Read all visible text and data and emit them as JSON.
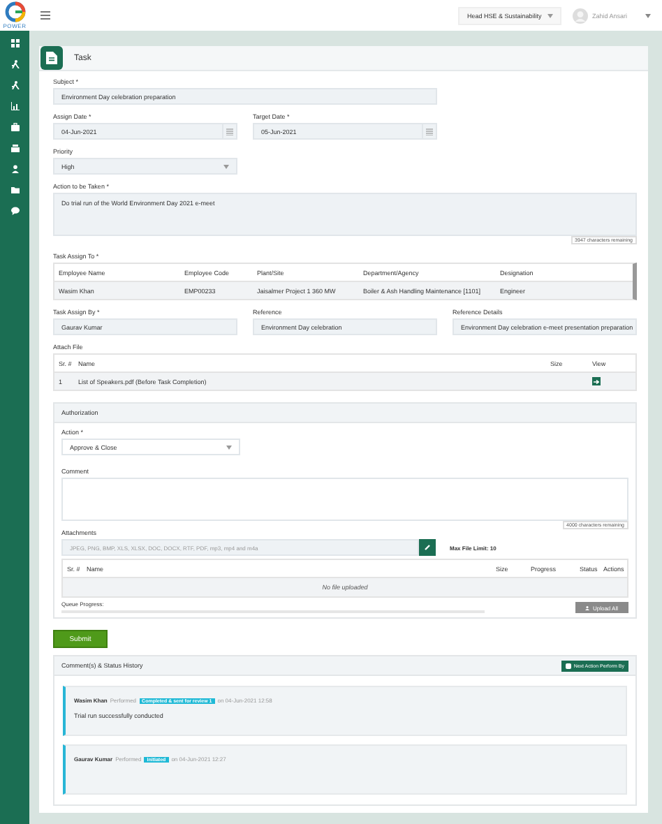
{
  "header": {
    "logo_text": "POWER",
    "role_selector": "Head HSE & Sustainability",
    "user_name": "Zahid Ansari"
  },
  "page_title": "Task",
  "subject": {
    "label": "Subject *",
    "value": "Environment Day celebration preparation"
  },
  "assign_date": {
    "label": "Assign Date *",
    "value": "04-Jun-2021"
  },
  "target_date": {
    "label": "Target Date *",
    "value": "05-Jun-2021"
  },
  "priority": {
    "label": "Priority",
    "value": "High"
  },
  "action_to_be_taken": {
    "label": "Action to be Taken *",
    "value": "Do trial run of the World Environment Day 2021 e-meet",
    "counter": "3947 characters remaining"
  },
  "task_assign_to": {
    "label": "Task Assign To *",
    "columns": [
      "Employee Name",
      "Employee Code",
      "Plant/Site",
      "Department/Agency",
      "Designation"
    ],
    "rows": [
      [
        "Wasim Khan",
        "EMP00233",
        "Jaisalmer Project 1 360 MW",
        "Boiler & Ash Handling Maintenance [1101]",
        "Engineer"
      ]
    ]
  },
  "task_assign_by": {
    "label": "Task Assign By *",
    "value": "Gaurav Kumar"
  },
  "reference": {
    "label": "Reference",
    "value": "Environment Day celebration"
  },
  "reference_details": {
    "label": "Reference Details",
    "value": "Environment Day celebration e-meet presentation preparation"
  },
  "attach_file": {
    "label": "Attach File",
    "columns": [
      "Sr. #",
      "Name",
      "Size",
      "View"
    ],
    "rows": [
      {
        "sr": "1",
        "name": "List of Speakers.pdf (Before Task Completion)",
        "size": ""
      }
    ]
  },
  "authorization": {
    "title": "Authorization",
    "action": {
      "label": "Action *",
      "value": "Approve & Close"
    },
    "comment": {
      "label": "Comment",
      "counter": "4000 characters remaining"
    },
    "attachments": {
      "label": "Attachments",
      "placeholder": "JPEG, PNG, BMP, XLS, XLSX, DOC, DOCX, RTF, PDF, mp3, mp4 and m4a",
      "limit": "Max File Limit: 10"
    },
    "upload_table": {
      "columns": [
        "Sr. #",
        "Name",
        "Size",
        "Progress",
        "Status",
        "Actions"
      ],
      "empty": "No file uploaded"
    },
    "queue_label": "Queue Progress:",
    "queue": {
      "level": 0
    },
    "upload_all": {
      "label": "Upload All",
      "disabled": true
    }
  },
  "submit": "Submit",
  "history": {
    "title": "Comment(s) & Status History",
    "next_action_button": "Next Action Perform By",
    "entries": [
      {
        "name": "Wasim Khan",
        "verb": "Performed",
        "status": "Completed & sent for review 1",
        "date": "on 04-Jun-2021 12:58",
        "comment": "Trial run successfully conducted"
      },
      {
        "name": "Gaurav Kumar",
        "verb": "Performed",
        "status": "Initiated",
        "date": "on 04-Jun-2021 12:27"
      }
    ]
  }
}
